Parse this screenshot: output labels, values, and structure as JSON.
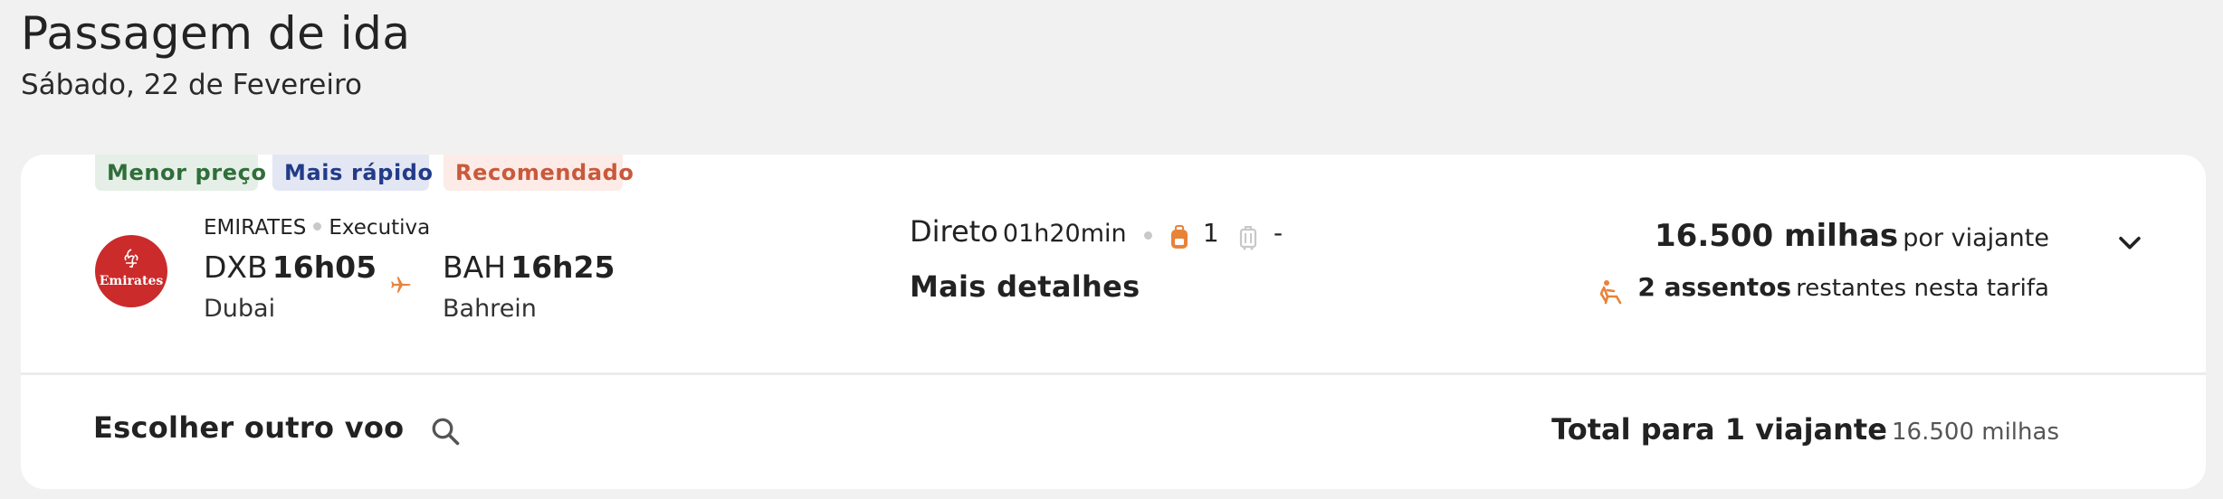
{
  "header": {
    "title": "Passagem de ida",
    "date": "Sábado, 22 de Fevereiro"
  },
  "flight": {
    "badges": [
      "Menor preço",
      "Mais rápido",
      "Recomendado"
    ],
    "airline": {
      "name": "EMIRATES",
      "cabin": "Executiva",
      "logo_text": "Emirates",
      "logo_color": "#cb2b2b"
    },
    "departure": {
      "code": "DXB",
      "time": "16h05",
      "city": "Dubai"
    },
    "arrival": {
      "code": "BAH",
      "time": "16h25",
      "city": "Bahrein"
    },
    "stops": "Direto",
    "duration": "01h20min",
    "carry_on_count": "1",
    "checked_bag": "-",
    "details_label": "Mais detalhes",
    "price": {
      "miles": "16.500 milhas",
      "per": "por viajante"
    },
    "seats": {
      "count": "2 assentos",
      "rest": "restantes nesta tarifa"
    }
  },
  "footer": {
    "other_flight": "Escolher outro voo",
    "total_label": "Total para 1 viajante",
    "total_miles": "16.500 milhas"
  },
  "colors": {
    "accent": "#e8833a",
    "badge_green": "#2f6e3a",
    "badge_blue": "#223b89",
    "badge_orange": "#c9593b"
  },
  "icons": [
    "plane-icon",
    "backpack-icon",
    "suitcase-icon",
    "seat-icon",
    "chevron-down-icon",
    "search-icon"
  ]
}
